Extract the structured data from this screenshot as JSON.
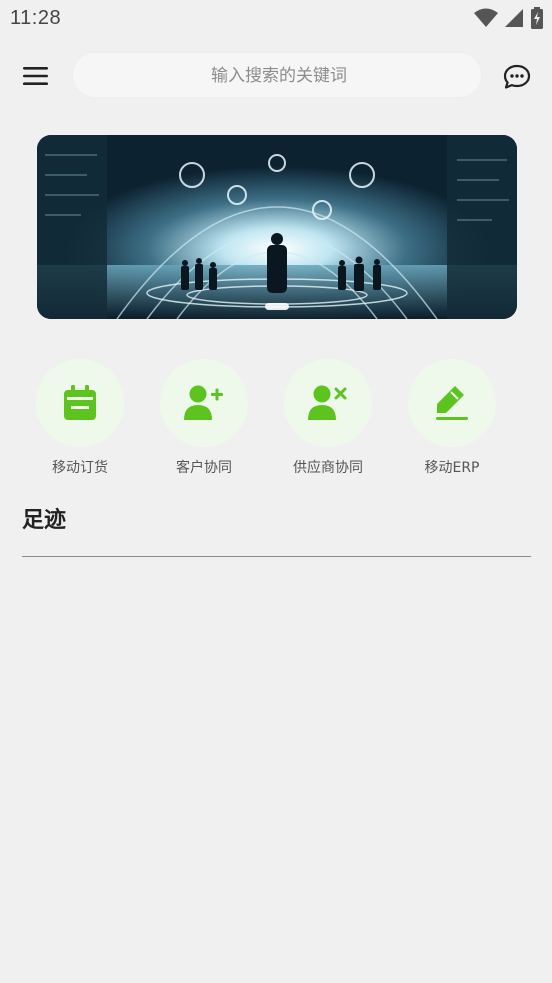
{
  "status_bar": {
    "time": "11:28",
    "icons": [
      "wifi-icon",
      "cellular-signal-icon",
      "battery-charging-icon"
    ]
  },
  "header": {
    "search_placeholder": "输入搜索的关键词",
    "menu_icon": "menu-icon",
    "message_icon": "message-icon"
  },
  "banner": {
    "carousel_active_index": 0
  },
  "shortcuts": [
    {
      "label": "移动订货",
      "icon": "calendar-icon"
    },
    {
      "label": "客户协同",
      "icon": "add-user-icon"
    },
    {
      "label": "供应商协同",
      "icon": "remove-user-icon"
    },
    {
      "label": "移动ERP",
      "icon": "edit-pencil-icon"
    }
  ],
  "footprint": {
    "title": "足迹"
  },
  "colors": {
    "accent": "#5cc31f",
    "icon_bg": "#eef9ec",
    "background": "#f0f0f0"
  }
}
